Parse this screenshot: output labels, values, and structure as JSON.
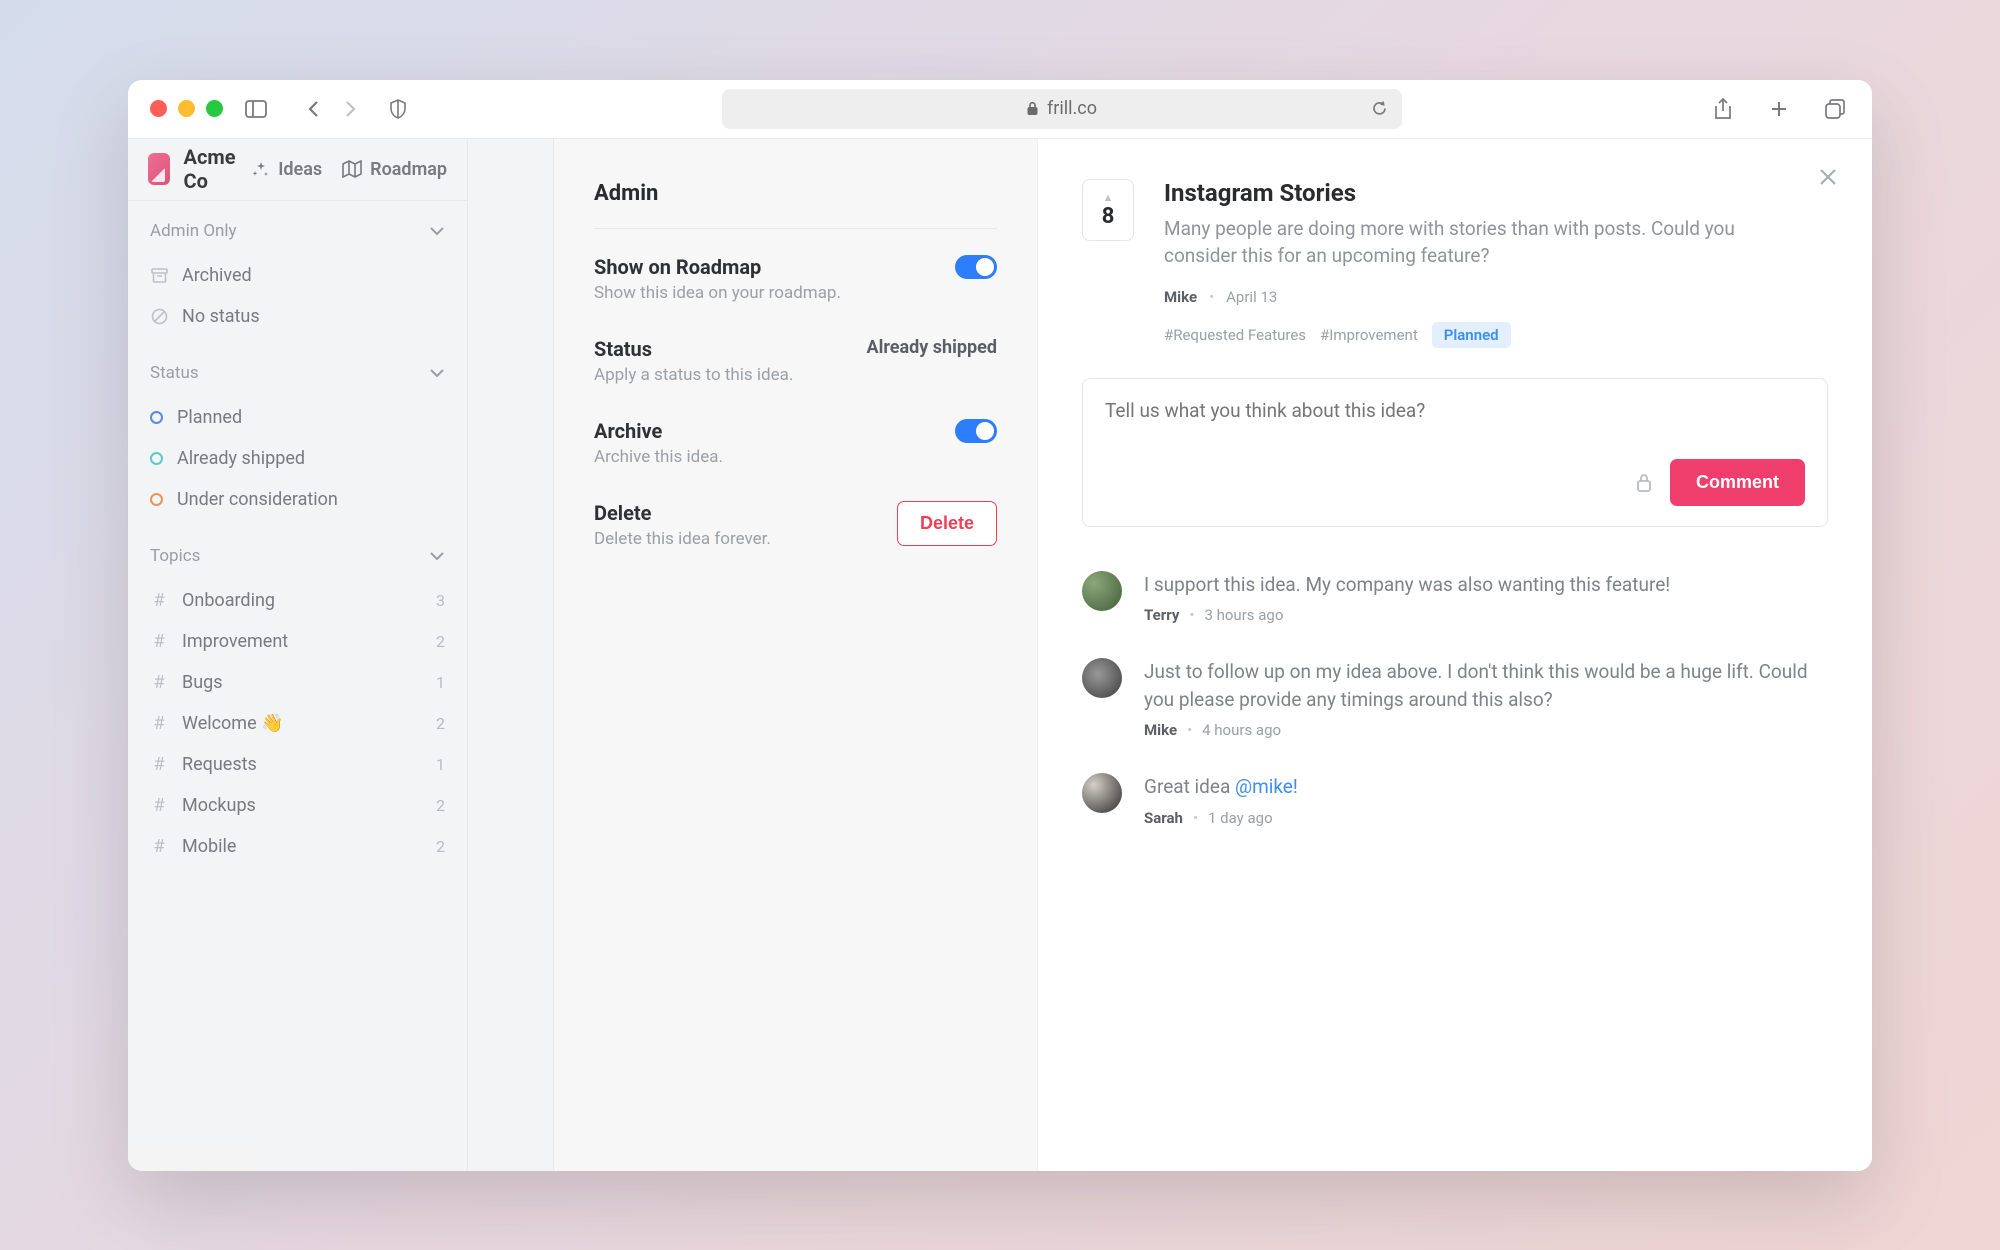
{
  "browser": {
    "url": "frill.co"
  },
  "brand": {
    "name": "Acme Co"
  },
  "topnav": {
    "ideas": "Ideas",
    "roadmap": "Roadmap"
  },
  "sidebar": {
    "adminOnly": {
      "header": "Admin Only",
      "archived": "Archived",
      "noStatus": "No status"
    },
    "status": {
      "header": "Status",
      "items": [
        {
          "label": "Planned",
          "color": "#4a7fe6"
        },
        {
          "label": "Already shipped",
          "color": "#4ec7c1"
        },
        {
          "label": "Under consideration",
          "color": "#e88b4b"
        }
      ]
    },
    "topics": {
      "header": "Topics",
      "items": [
        {
          "label": "Onboarding",
          "count": "3"
        },
        {
          "label": "Improvement",
          "count": "2"
        },
        {
          "label": "Bugs",
          "count": "1"
        },
        {
          "label": "Welcome 👋",
          "count": "2"
        },
        {
          "label": "Requests",
          "count": "1"
        },
        {
          "label": "Mockups",
          "count": "2"
        },
        {
          "label": "Mobile",
          "count": "2"
        }
      ]
    }
  },
  "admin": {
    "title": "Admin",
    "showRoadmap": {
      "label": "Show on Roadmap",
      "sub": "Show this idea on your roadmap."
    },
    "status": {
      "label": "Status",
      "sub": "Apply a status to this idea.",
      "value": "Already shipped"
    },
    "archive": {
      "label": "Archive",
      "sub": "Archive this idea."
    },
    "delete": {
      "label": "Delete",
      "sub": "Delete this idea forever.",
      "button": "Delete"
    }
  },
  "idea": {
    "votes": "8",
    "title": "Instagram Stories",
    "description": "Many people are doing more with stories than with posts. Could you consider this for an upcoming feature?",
    "author": "Mike",
    "date": "April 13",
    "tags": {
      "t1": "#Requested Features",
      "t2": "#Improvement"
    },
    "badge": "Planned",
    "commentPlaceholder": "Tell us what you think about this idea?",
    "commentButton": "Comment"
  },
  "comments": [
    {
      "text": "I support this idea. My company was also wanting this feature!",
      "author": "Terry",
      "time": "3 hours ago"
    },
    {
      "text": "Just to follow up on my idea above. I don't think this would be a huge lift. Could you please provide any timings around this also?",
      "author": "Mike",
      "time": "4 hours ago"
    },
    {
      "text": "Great idea ",
      "mention": "@mike!",
      "author": "Sarah",
      "time": "1 day ago"
    }
  ]
}
